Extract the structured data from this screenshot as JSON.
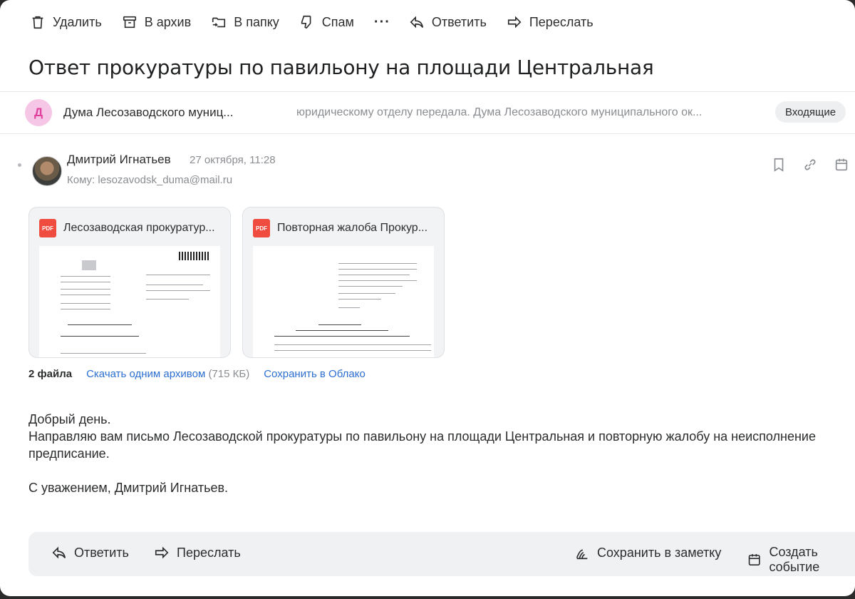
{
  "toolbar": {
    "delete": "Удалить",
    "archive": "В архив",
    "to_folder": "В папку",
    "spam": "Спам",
    "more": "···",
    "reply": "Ответить",
    "forward": "Переслать"
  },
  "subject": "Ответ прокуратуры по павильону на площади Центральная",
  "thread": {
    "avatar_letter": "Д",
    "sender": "Дума Лесозаводского муниц...",
    "snippet": "юридическому отделу передала. Дума Лесозаводского муниципального ок...",
    "folder": "Входящие"
  },
  "message": {
    "from": "Дмитрий Игнатьев",
    "date": "27 октября, 11:28",
    "to": "Кому: lesozavodsk_duma@mail.ru"
  },
  "attachments": [
    {
      "name": "Лесозаводская прокуратур...",
      "type_label": "PDF"
    },
    {
      "name": "Повторная жалоба Прокур...",
      "type_label": "PDF"
    }
  ],
  "files": {
    "count": "2 файла",
    "download_all": "Скачать одним архивом",
    "size": "(715 КБ)",
    "save_cloud": "Сохранить в Облако"
  },
  "body": {
    "line1": "Добрый день.",
    "line2": "Направляю вам письмо Лесозаводской прокуратуры по павильону на площади Центральная и повторную жалобу на неисполнение предписание.",
    "line3": "С уважением, Дмитрий Игнатьев."
  },
  "reply_bar": {
    "reply": "Ответить",
    "forward": "Переслать",
    "save_note": "Сохранить в заметку",
    "create_event": "Создать событие"
  }
}
